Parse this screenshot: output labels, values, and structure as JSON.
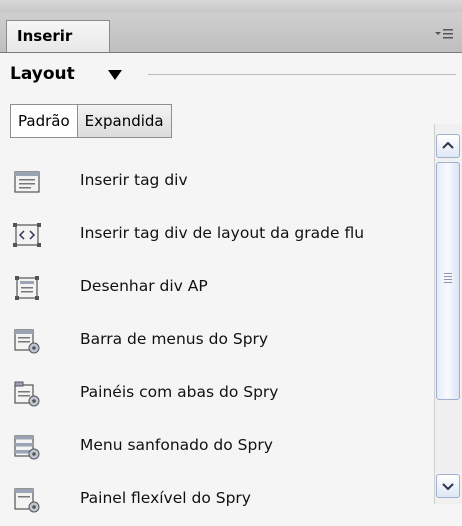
{
  "panel": {
    "tab_label": "Inserir",
    "menu_icon": "panel-menu-icon"
  },
  "section": {
    "title": "Layout",
    "dropdown_icon": "chevron-down-icon"
  },
  "view_tabs": [
    {
      "label": "Padrão",
      "active": true
    },
    {
      "label": "Expandida",
      "active": false
    }
  ],
  "items": [
    {
      "label": "Inserir tag div",
      "icon": "div-icon"
    },
    {
      "label": "Inserir tag div de layout da grade flu",
      "icon": "fluid-grid-div-icon"
    },
    {
      "label": "Desenhar div AP",
      "icon": "ap-div-icon"
    },
    {
      "label": "Barra de menus do Spry",
      "icon": "spry-menu-bar-icon"
    },
    {
      "label": "Painéis com abas do Spry",
      "icon": "spry-tabbed-panels-icon"
    },
    {
      "label": "Menu sanfonado do Spry",
      "icon": "spry-accordion-icon"
    },
    {
      "label": "Painel flexível do Spry",
      "icon": "spry-collapsible-panel-icon"
    }
  ],
  "scrollbar": {
    "up_icon": "scroll-up-icon",
    "down_icon": "scroll-down-icon"
  }
}
